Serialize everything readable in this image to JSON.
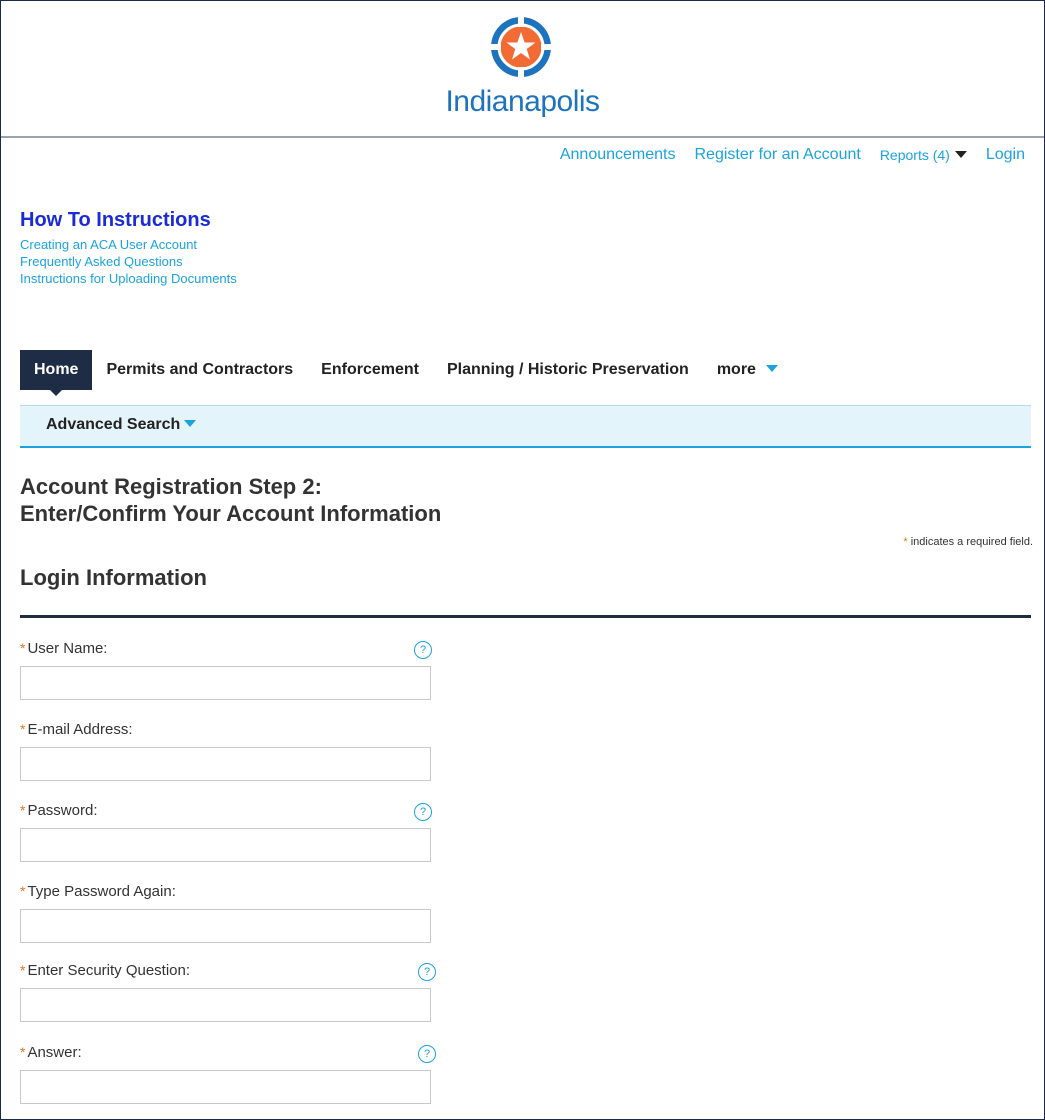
{
  "header": {
    "city_name": "Indianapolis",
    "logo": "star-seal-icon",
    "colors": {
      "logo_blue": "#1e73be",
      "logo_orange": "#f26b35"
    }
  },
  "top_links": {
    "announcements": "Announcements",
    "register": "Register for an Account",
    "reports": "Reports (4)",
    "login": "Login"
  },
  "how_to": {
    "title": "How To Instructions",
    "links": [
      "Creating an ACA User Account",
      "Frequently Asked Questions",
      "Instructions for Uploading Documents"
    ]
  },
  "nav": {
    "items": [
      "Home",
      "Permits and Contractors",
      "Enforcement",
      "Planning / Historic Preservation",
      "more"
    ],
    "active": "Home"
  },
  "subnav": {
    "advanced_search": "Advanced Search"
  },
  "page": {
    "title_line1": "Account Registration Step 2:",
    "title_line2": "Enter/Confirm Your Account Information",
    "required_star": "*",
    "required_note": "indicates a required field.",
    "section_title": "Login Information"
  },
  "fields": [
    {
      "label": "User Name:",
      "value": "",
      "help": true
    },
    {
      "label": "E-mail Address:",
      "value": "",
      "help": false
    },
    {
      "label": "Password:",
      "value": "",
      "help": true
    },
    {
      "label": "Type Password Again:",
      "value": "",
      "help": false
    },
    {
      "label": "Enter Security Question:",
      "value": "",
      "help": true
    },
    {
      "label": "Answer:",
      "value": "",
      "help": true
    }
  ]
}
